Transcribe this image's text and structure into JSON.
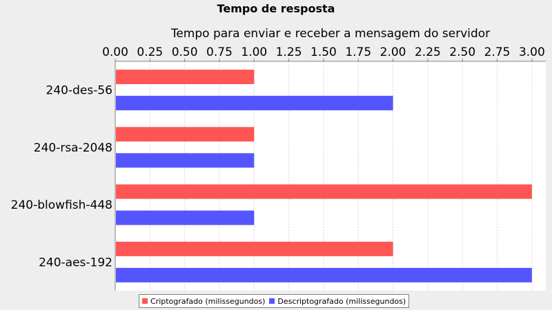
{
  "chart_data": {
    "type": "bar",
    "orientation": "horizontal",
    "title": "Tempo de resposta",
    "xlabel": "Tempo para enviar e receber a mensagem do servidor",
    "ylabel": "",
    "xlim": [
      0,
      3.1
    ],
    "ticks": [
      "0.00",
      "0.25",
      "0.50",
      "0.75",
      "1.00",
      "1.25",
      "1.50",
      "1.75",
      "2.00",
      "2.25",
      "2.50",
      "2.75",
      "3.00"
    ],
    "tick_values": [
      0,
      0.25,
      0.5,
      0.75,
      1,
      1.25,
      1.5,
      1.75,
      2,
      2.25,
      2.5,
      2.75,
      3
    ],
    "categories": [
      "240-des-56",
      "240-rsa-2048",
      "240-blowfish-448",
      "240-aes-192"
    ],
    "series": [
      {
        "name": "Criptografado (milissegundos)",
        "color": "#ff5555",
        "values": [
          1,
          1,
          3,
          2
        ]
      },
      {
        "name": "Descriptografado (milissegundos)",
        "color": "#5555ff",
        "values": [
          2,
          1,
          1,
          3
        ]
      }
    ],
    "grid": true,
    "legend_position": "bottom"
  }
}
